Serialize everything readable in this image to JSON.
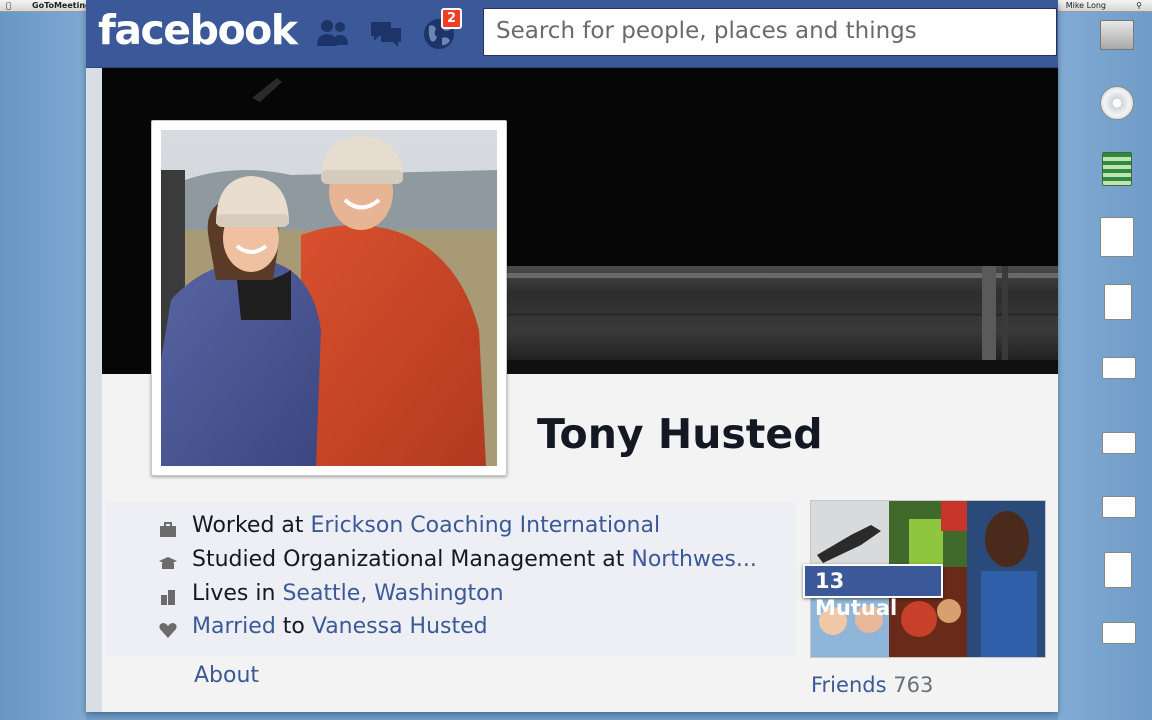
{
  "desktop": {
    "menubar": {
      "app_name": "GoToMeeting",
      "user_name": "Mike Long"
    },
    "icons": [
      {
        "name": "hard-drive-icon"
      },
      {
        "name": "dvd-icon"
      },
      {
        "name": "spreadsheet-icon"
      },
      {
        "name": "document-icon"
      },
      {
        "name": "pdf-icon"
      },
      {
        "name": "screenshot-icon"
      }
    ]
  },
  "facebook": {
    "logo": "facebook",
    "notifications_count": "2",
    "search_placeholder": "Search for people, places and things"
  },
  "profile": {
    "name": "Tony Husted",
    "work_prefix": "Worked at ",
    "work_link": "Erickson Coaching International",
    "study_prefix": "Studied Organizational Management at ",
    "study_link": "Northwes...",
    "lives_prefix": "Lives in ",
    "lives_link": "Seattle, Washington",
    "relationship_link": "Married",
    "relationship_mid": " to ",
    "spouse_link": "Vanessa Husted",
    "about_label": "About"
  },
  "friends": {
    "mutual_label": "13 Mutual",
    "label": "Friends",
    "count": "763"
  },
  "colors": {
    "facebook_blue": "#3b5998",
    "link_blue": "#3b5998",
    "badge_red": "#f03d25",
    "info_bg": "#edeff4"
  }
}
